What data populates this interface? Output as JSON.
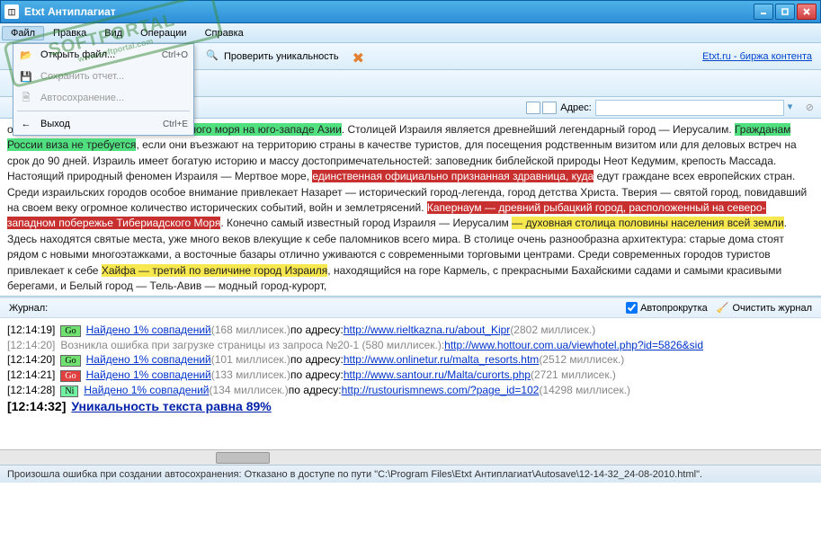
{
  "window": {
    "title": "Etxt Антиплагиат"
  },
  "menubar": {
    "items": [
      "Файл",
      "Правка",
      "Вид",
      "Операции",
      "Справка"
    ]
  },
  "fileMenu": {
    "items": [
      {
        "label": "Открыть файл...",
        "shortcut": "Ctrl+O",
        "icon": "folder-open-icon"
      },
      {
        "label": "Сохранить отчет...",
        "shortcut": "",
        "icon": "save-icon",
        "disabled": true
      },
      {
        "label": "Автосохранение...",
        "shortcut": "",
        "icon": "autosave-icon",
        "disabled": true
      },
      {
        "label": "Выход",
        "shortcut": "Ctrl+E",
        "icon": "exit-icon"
      }
    ]
  },
  "toolbar": {
    "check": "Проверить уникальность",
    "link": "Etxt.ru - биржа контента"
  },
  "addressBar": {
    "label": "Адрес:",
    "value": ""
  },
  "content": {
    "p1a": "о ",
    "p1b": "у восточного побережья Средиземного моря на юго-западе Азии",
    "p1c": ". Столицей Израиля является древнейший легендарный город — Иерусалим. ",
    "p1d": "Гражданам России виза не требуется",
    "p1e": ", если они въезжают на территорию страны в качестве туристов, для посещения родственным визитом или для деловых встреч на срок до 90 дней. Израиль имеет богатую историю и массу достопримечательностей: заповедник библейской природы Неот Кедумим, крепость Массада. Настоящий природный феномен Израиля — Мертвое море, ",
    "p1f": "единственная официально признанная здравница, куда",
    "p1g": " едут граждане всех европейских стран. Среди израильских городов особое внимание привлекает Назарет — исторический город-легенда, город детства Христа. Тверия — святой город, повидавший на своем веку огромное количество исторических событий, войн и землетрясений. ",
    "p1h": "Капернаум — древний рыбацкий город, расположенный на северо-западном побережье Тибериадского Моря",
    "p1i": ". Конечно самый известный город Израиля — Иерусалим ",
    "p1j": "— духовная столица половины населения всей земли",
    "p1k": ". Здесь находятся святые места, уже много веков влекущие к себе паломников всего мира. В столице очень разнообразна архитектура: старые дома стоят рядом с новыми многоэтажками, а восточные базары отлично уживаются с современными торговыми центрами. Среди современных городов туристов привлекает к себе ",
    "p1l": "Хайфа — третий по величине город Израиля",
    "p1m": ", находящийся на горе Кармель, с прекрасными Бахайскими садами и самыми красивыми берегами, и Белый город — Тель-Авив — модный город-курорт,"
  },
  "journal": {
    "title": "Журнал:",
    "autoscroll": "Автопрокрутка",
    "clear": "Очистить журнал",
    "foundLabel": "Найдено 1% совпадений",
    "byAddr": " по адресу: ",
    "lines": [
      {
        "time": "[12:14:19]",
        "badge": "Go",
        "badgeClass": "go-g",
        "ms1": "(168 миллисек.)",
        "url": "http://www.rieltkazna.ru/about_Kipr",
        "ms2": "(2802 миллисек.)"
      },
      {
        "time": "[12:14:20]",
        "error": "Возникла ошибка при загрузке страницы из запроса №20-1 (580 миллисек.): ",
        "url": "http://www.hottour.com.ua/viewhotel.php?id=5826&sid"
      },
      {
        "time": "[12:14:20]",
        "badge": "Go",
        "badgeClass": "go-g",
        "ms1": "(101 миллисек.)",
        "url": "http://www.onlinetur.ru/malta_resorts.htm",
        "ms2": "(2512 миллисек.)"
      },
      {
        "time": "[12:14:21]",
        "badge": "Go",
        "badgeClass": "go-r",
        "ms1": "(133 миллисек.)",
        "url": "http://www.santour.ru/Malta/curorts.php",
        "ms2": "(2721 миллисек.)"
      },
      {
        "time": "[12:14:28]",
        "badge": "Ni",
        "badgeClass": "ni",
        "ms1": "(134 миллисек.)",
        "url": "http://rustourismnews.com/?page_id=102",
        "ms2": "(14298 миллисек.)"
      }
    ],
    "result": {
      "time": "[12:14:32]",
      "text": "Уникальность текста равна 89%"
    }
  },
  "statusbar": {
    "text": "Произошла ошибка при создании автосохранения: Отказано в доступе по пути \"C:\\Program Files\\Etxt Антиплагиат\\Autosave\\12-14-32_24-08-2010.html\"."
  },
  "watermark": {
    "big": "SOFTPORTAL",
    "small": "www.softportal.com",
    "tm": "™"
  }
}
